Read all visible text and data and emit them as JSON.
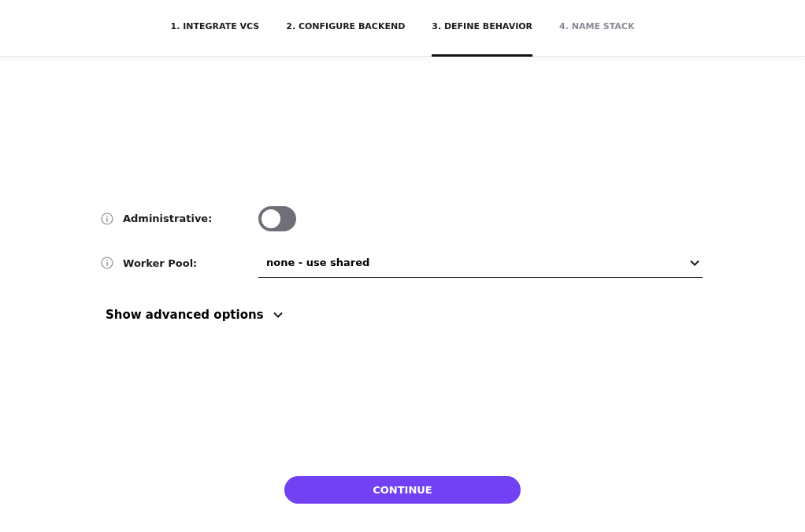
{
  "steps": [
    {
      "label": "1. INTEGRATE VCS",
      "selected": false,
      "disabled": false
    },
    {
      "label": "2. CONFIGURE BACKEND",
      "selected": false,
      "disabled": false
    },
    {
      "label": "3. DEFINE BEHAVIOR",
      "selected": true,
      "disabled": false
    },
    {
      "label": "4. NAME STACK",
      "selected": false,
      "disabled": true
    }
  ],
  "fields": [
    {
      "kind": "toggle",
      "label": "Administrative:",
      "on": false
    },
    {
      "kind": "select",
      "label": "Worker Pool:",
      "value": "none - use shared"
    }
  ],
  "advanced": {
    "label": "Show advanced options",
    "expanded": false
  },
  "continue_button": "CONTINUE"
}
